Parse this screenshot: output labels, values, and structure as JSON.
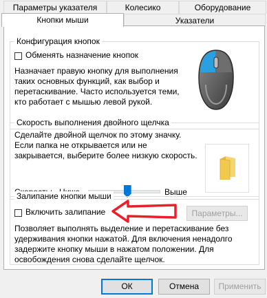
{
  "tabs_row1": [
    "Параметры указателя",
    "Колесико",
    "Оборудование"
  ],
  "tabs_row2": [
    "Кнопки мыши",
    "Указатели"
  ],
  "button_config": {
    "legend": "Конфигурация кнопок",
    "swap_label": "Обменять назначение кнопок",
    "description": [
      "Назначает правую кнопку для выполнения",
      "таких основных функций, как выбор и",
      "перетаскивание. Часто используется теми,",
      "кто работает с мышью левой рукой."
    ]
  },
  "double_click": {
    "legend": "Скорость выполнения двойного щелчка",
    "description": [
      "Сделайте двойной щелчок по этому значку.",
      "Если папка не открывается или не",
      "закрывается, выберите более низкую скорость."
    ],
    "speed_label": "Скорость:",
    "slow_label": "Ниже",
    "fast_label": "Выше",
    "speed_value": 0.55
  },
  "click_lock": {
    "legend": "Залипание кнопки мыши",
    "enable_label": "Включить залипание",
    "settings_button": "Параметры...",
    "description": [
      "Позволяет выполнять выделение и перетаскивание без",
      "удерживания кнопки нажатой. Для включения ненадолго",
      "задержите кнопку мыши в нажатом положении. Для",
      "освобождения снова сделайте щелчок."
    ]
  },
  "footer": {
    "ok": "ОК",
    "cancel": "Отмена",
    "apply": "Применить"
  },
  "colors": {
    "accent": "#0078d7",
    "annotation_arrow": "#e8202a",
    "mouse_primary": "#2aa0e0"
  }
}
